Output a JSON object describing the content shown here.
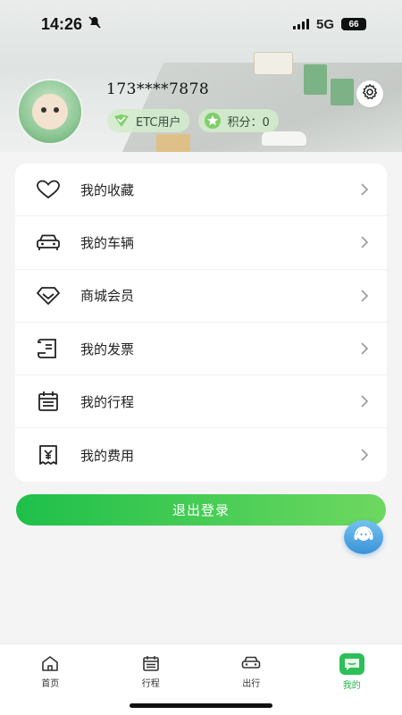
{
  "status_bar": {
    "time": "14:26",
    "network": "5G",
    "battery": "66"
  },
  "profile": {
    "phone": "173****7878",
    "etc_badge": "ETC用户",
    "points_badge": "积分：0"
  },
  "menu": [
    {
      "label": "我的收藏",
      "icon": "heart-icon"
    },
    {
      "label": "我的车辆",
      "icon": "car-icon"
    },
    {
      "label": "商城会员",
      "icon": "diamond-icon"
    },
    {
      "label": "我的发票",
      "icon": "invoice-icon"
    },
    {
      "label": "我的行程",
      "icon": "calendar-icon"
    },
    {
      "label": "我的费用",
      "icon": "yen-receipt-icon"
    }
  ],
  "logout_label": "退出登录",
  "tabs": [
    {
      "label": "首页",
      "icon": "home-icon"
    },
    {
      "label": "行程",
      "icon": "calendar-icon"
    },
    {
      "label": "出行",
      "icon": "car-icon"
    },
    {
      "label": "我的",
      "icon": "profile-icon",
      "active": true
    }
  ],
  "colors": {
    "accent": "#1fb24a",
    "logout_start": "#1ec04a",
    "logout_end": "#6ed860"
  }
}
